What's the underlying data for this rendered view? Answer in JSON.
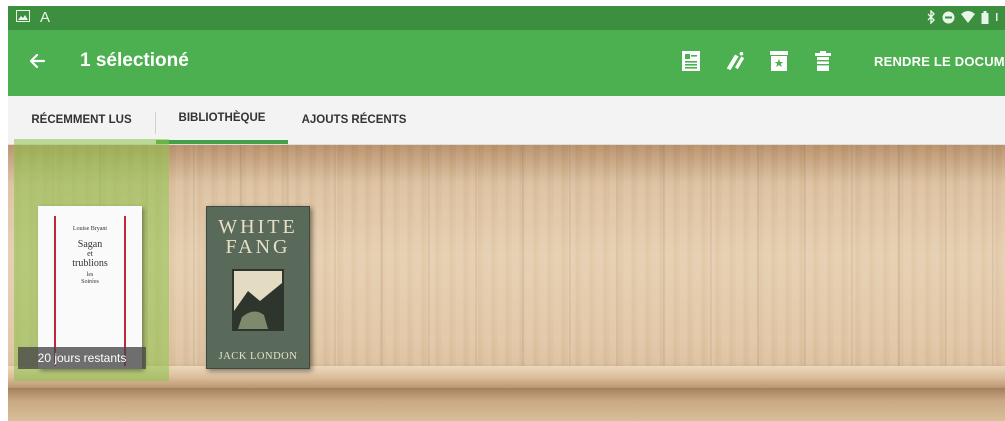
{
  "status": {
    "app_letter": "A"
  },
  "appbar": {
    "title": "1 sélectioné",
    "return_label": "RENDRE LE DOCUME"
  },
  "tabs": [
    {
      "label": "RÉCEMMENT LUS"
    },
    {
      "label": "BIBLIOTHÈQUE"
    },
    {
      "label": "AJOUTS RÉCENTS"
    }
  ],
  "books": [
    {
      "cover_lines": [
        "Louise Bryant",
        "Sagan",
        "et",
        "trublions",
        "les",
        "Soirées"
      ],
      "badge": "20 jours restants"
    },
    {
      "title_line1": "WHITE",
      "title_line2": "FANG",
      "author": "JACK LONDON"
    }
  ],
  "colors": {
    "statusbar": "#3b8f3e",
    "appbar": "#4caf50",
    "tab_indicator": "#43a047",
    "selection": "#8bc34a"
  }
}
